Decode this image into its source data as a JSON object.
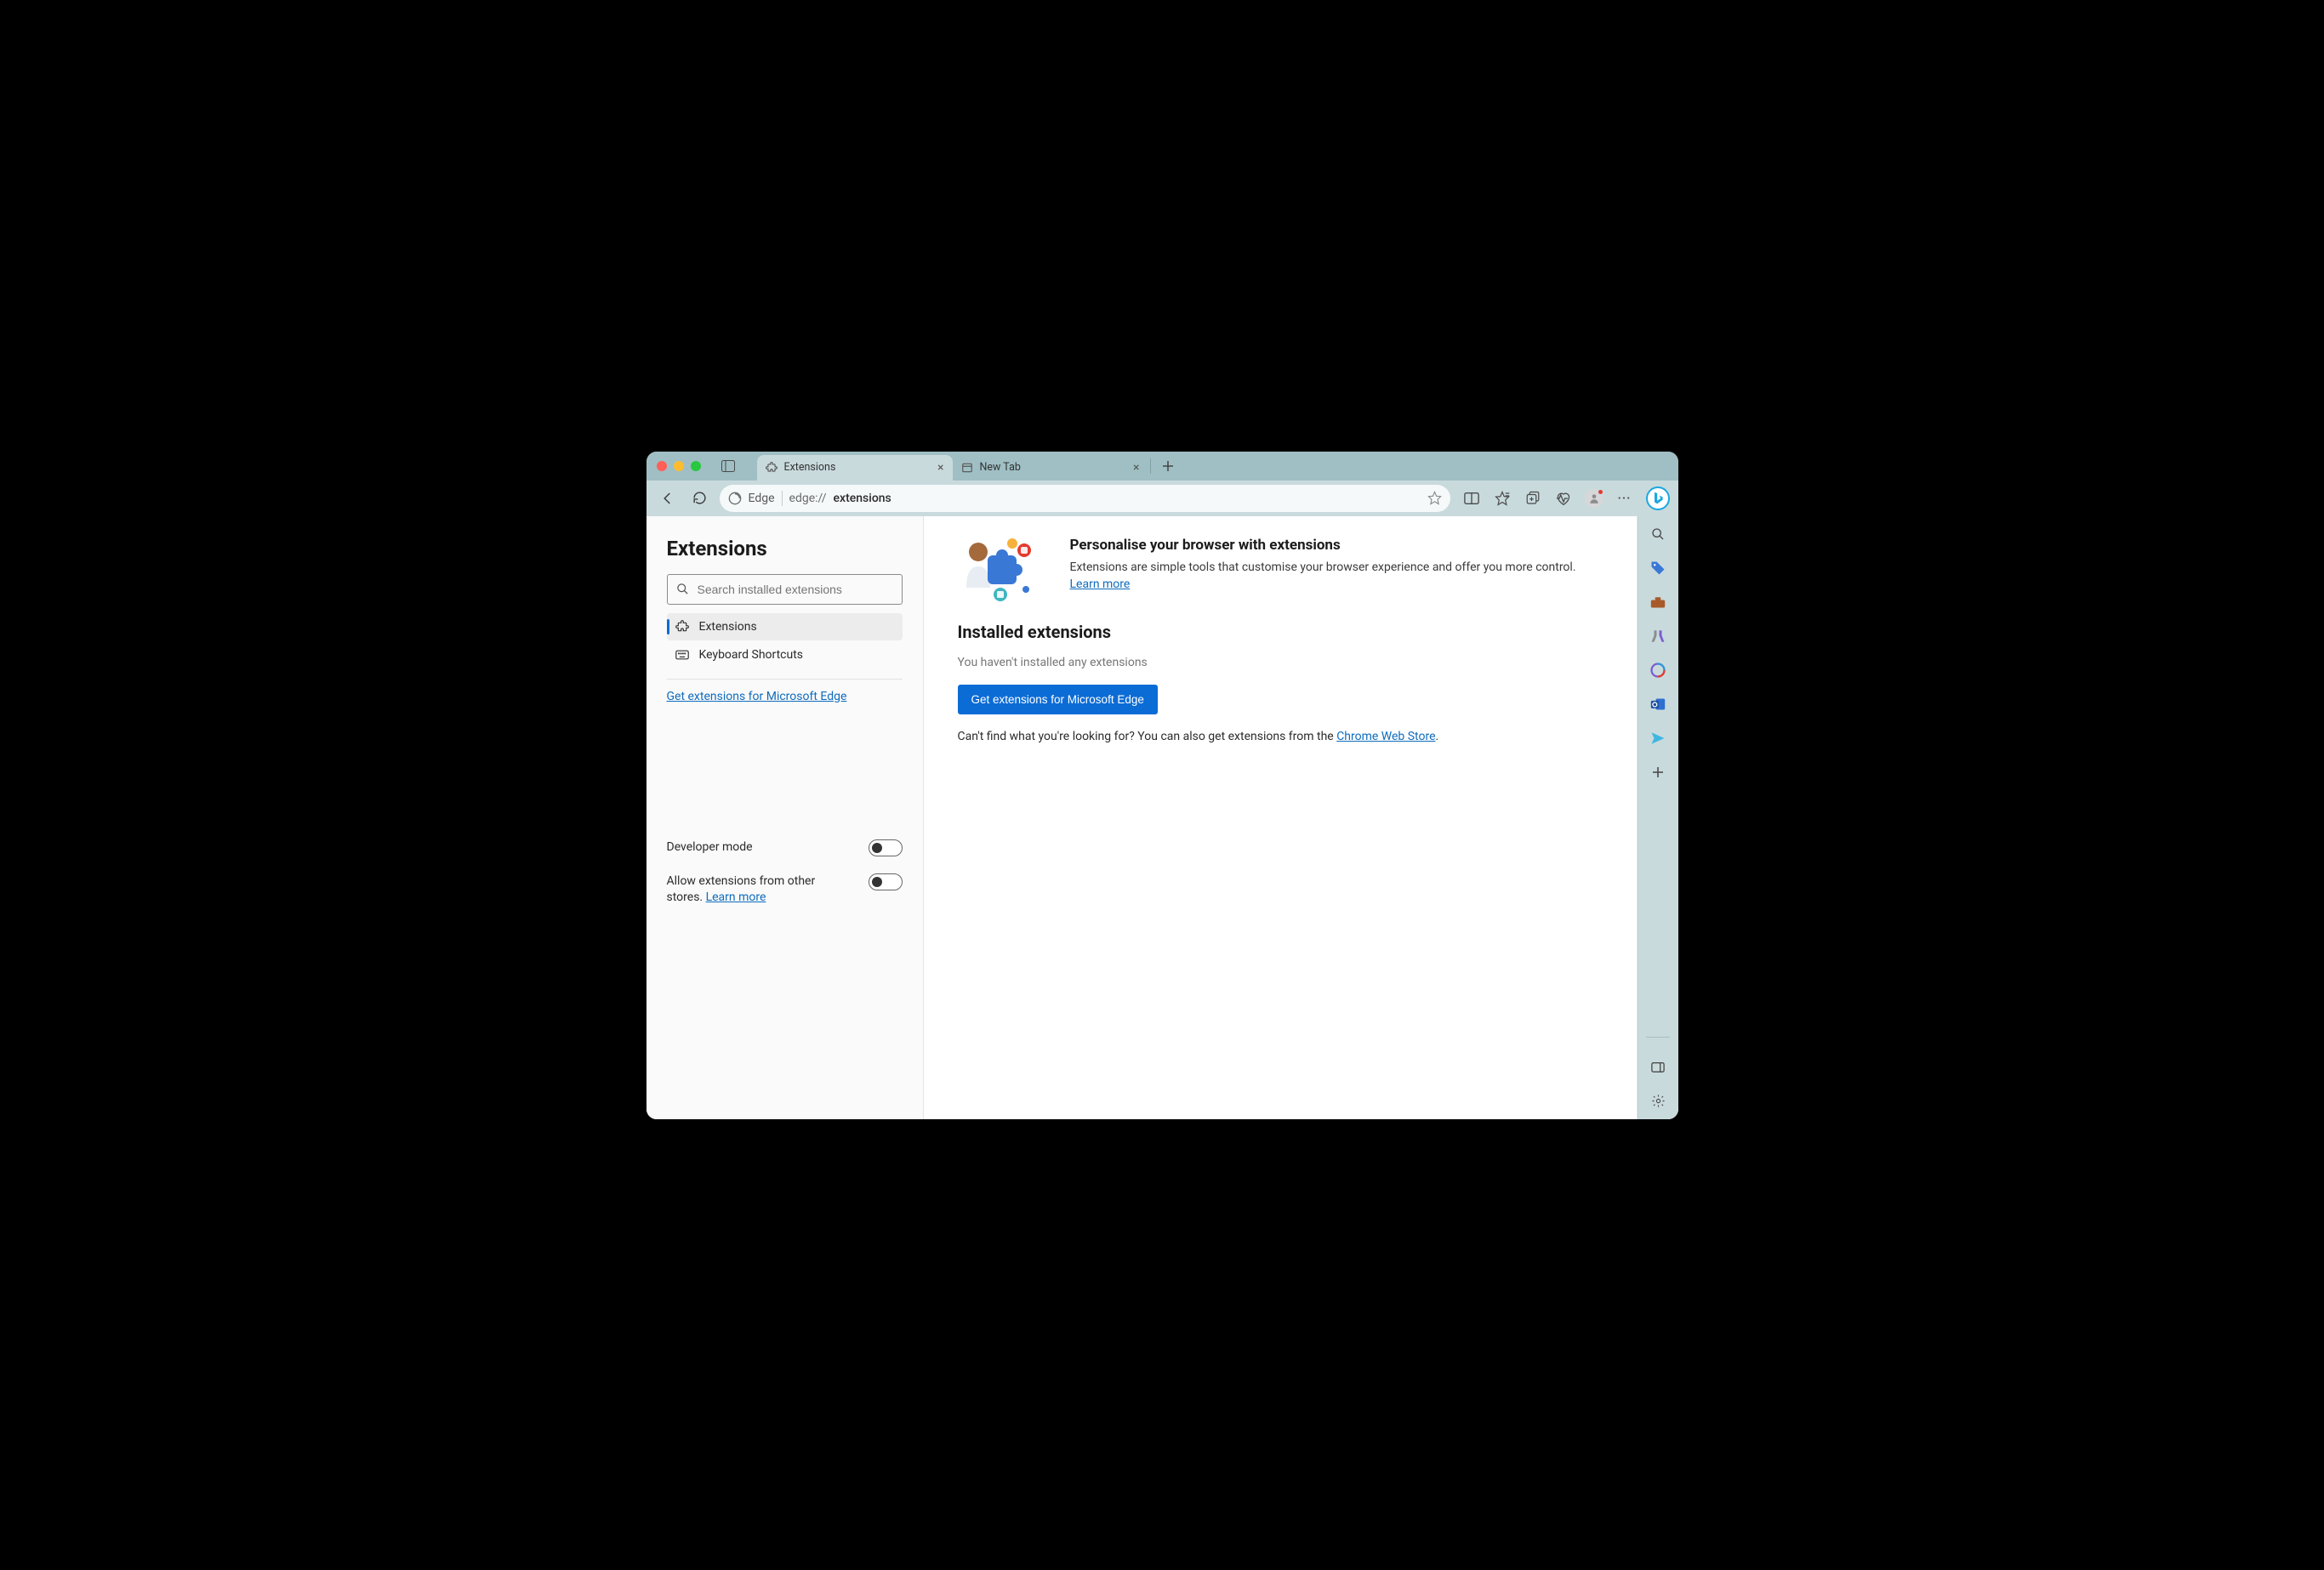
{
  "tabs": [
    {
      "title": "Extensions"
    },
    {
      "title": "New Tab"
    }
  ],
  "addressbar": {
    "engine": "Edge",
    "scheme": "edge://",
    "path": "extensions"
  },
  "sidebar": {
    "title": "Extensions",
    "search_placeholder": "Search installed extensions",
    "nav": [
      {
        "label": "Extensions"
      },
      {
        "label": "Keyboard Shortcuts"
      }
    ],
    "get_link": "Get extensions for Microsoft Edge",
    "settings": {
      "dev_mode": "Developer mode",
      "allow_other_pre": "Allow extensions from other stores. ",
      "allow_other_link": "Learn more"
    }
  },
  "main": {
    "promo_title": "Personalise your browser with extensions",
    "promo_body": "Extensions are simple tools that customise your browser experience and offer you more control. ",
    "promo_link": "Learn more",
    "section_title": "Installed extensions",
    "empty_text": "You haven't installed any extensions",
    "cta": "Get extensions for Microsoft Edge",
    "after_pre": "Can't find what you're looking for? You can also get extensions from the ",
    "after_link": "Chrome Web Store",
    "after_post": "."
  }
}
